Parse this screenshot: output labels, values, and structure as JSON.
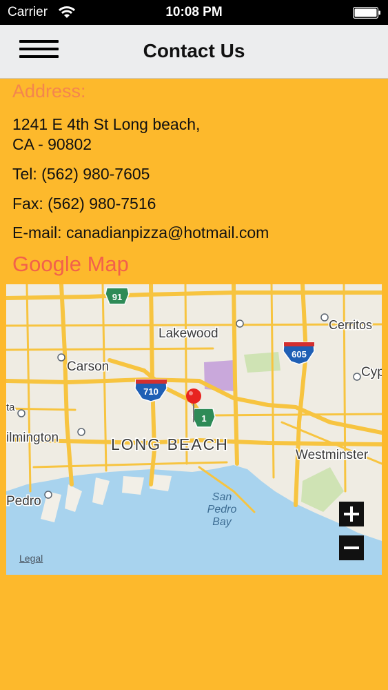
{
  "status_bar": {
    "carrier": "Carrier",
    "time": "10:08 PM",
    "icons": [
      "wifi-icon",
      "battery-icon"
    ]
  },
  "nav": {
    "title": "Contact Us",
    "menu_icon": "hamburger-menu-icon"
  },
  "contact": {
    "address_label": "Address:",
    "address_line1": "1241 E 4th St Long beach,",
    "address_line2": "CA - 90802",
    "tel": "Tel: (562) 980-7605",
    "fax": "Fax: (562) 980-7516",
    "email": "E-mail: canadianpizza@hotmail.com"
  },
  "map": {
    "heading": "Google Map",
    "legal_link": "Legal",
    "zoom_in": "+",
    "zoom_out": "−",
    "labels": {
      "lakewood": "Lakewood",
      "carson": "Carson",
      "cerritos": "Cerritos",
      "cyp": "Cyp",
      "long_beach": "LONG BEACH",
      "westminster": "Westminster",
      "wilmington": "ilmington",
      "pedro": "Pedro",
      "ta": "ta",
      "bay1": "San",
      "bay2": "Pedro",
      "bay3": "Bay"
    },
    "shields": {
      "hwy91": "91",
      "i605": "605",
      "i710": "710",
      "hwy1": "1"
    },
    "pin_icon": "map-pin-icon",
    "colors": {
      "road": "#F7C440",
      "water": "#A8D3EE",
      "land": "#EFECE3",
      "pin": "#E8231F"
    }
  },
  "theme": {
    "background": "#FDB92C",
    "nav_background": "#ECEDEE",
    "label_orange": "#F4854E",
    "map_heading": "#F2614B"
  }
}
